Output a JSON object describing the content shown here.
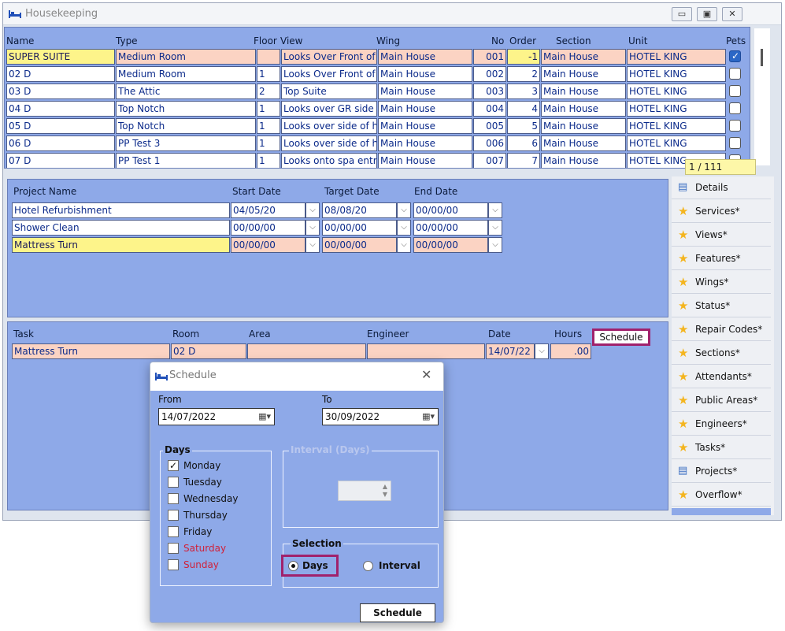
{
  "window": {
    "title": "Housekeeping",
    "controls": [
      "▭",
      "▣",
      "✕"
    ]
  },
  "rooms": {
    "headers": {
      "name": "Name",
      "type": "Type",
      "floor": "Floor",
      "view": "View",
      "wing": "Wing",
      "no": "No",
      "order": "Order",
      "section": "Section",
      "unit": "Unit",
      "pets": "Pets"
    },
    "rows": [
      {
        "name": "SUPER SUITE",
        "type": "Medium Room",
        "floor": "",
        "view": "Looks Over Front of",
        "wing": "Main House",
        "no": "001",
        "order": "-1",
        "section": "Main House",
        "unit": "HOTEL KING",
        "pets": true
      },
      {
        "name": "02 D",
        "type": "Medium Room",
        "floor": "1",
        "view": "Looks Over Front of",
        "wing": "Main House",
        "no": "002",
        "order": "2",
        "section": "Main House",
        "unit": "HOTEL KING",
        "pets": false
      },
      {
        "name": "03 D",
        "type": "The Attic",
        "floor": "2",
        "view": "Top Suite",
        "wing": "Main House",
        "no": "003",
        "order": "3",
        "section": "Main House",
        "unit": "HOTEL KING",
        "pets": false
      },
      {
        "name": "04 D",
        "type": "Top Notch",
        "floor": "1",
        "view": "Looks over GR side",
        "wing": "Main House",
        "no": "004",
        "order": "4",
        "section": "Main House",
        "unit": "HOTEL KING",
        "pets": false
      },
      {
        "name": "05 D",
        "type": "Top Notch",
        "floor": "1",
        "view": "Looks over side of h",
        "wing": "Main House",
        "no": "005",
        "order": "5",
        "section": "Main House",
        "unit": "HOTEL KING",
        "pets": false
      },
      {
        "name": "06 D",
        "type": "PP Test 3",
        "floor": "1",
        "view": "Looks over side of h",
        "wing": "Main House",
        "no": "006",
        "order": "6",
        "section": "Main House",
        "unit": "HOTEL KING",
        "pets": false
      },
      {
        "name": "07 D",
        "type": "PP Test 1",
        "floor": "1",
        "view": "Looks onto spa entr",
        "wing": "Main House",
        "no": "007",
        "order": "7",
        "section": "Main House",
        "unit": "HOTEL KING",
        "pets": false
      }
    ],
    "pager": "1 / 111"
  },
  "projects": {
    "headers": {
      "name": "Project Name",
      "start": "Start Date",
      "target": "Target Date",
      "end": "End Date"
    },
    "rows": [
      {
        "name": "Hotel Refurbishment",
        "start": "04/05/20",
        "target": "08/08/20",
        "end": "00/00/00"
      },
      {
        "name": "Shower Clean",
        "start": "00/00/00",
        "target": "00/00/00",
        "end": "00/00/00"
      },
      {
        "name": "Mattress Turn",
        "start": "00/00/00",
        "target": "00/00/00",
        "end": "00/00/00"
      }
    ]
  },
  "tasks": {
    "headers": {
      "task": "Task",
      "room": "Room",
      "area": "Area",
      "engineer": "Engineer",
      "date": "Date",
      "hours": "Hours"
    },
    "rows": [
      {
        "task": "Mattress Turn",
        "room": "02 D",
        "area": "",
        "engineer": "",
        "date": "14/07/22",
        "hours": ".00"
      }
    ],
    "schedule_button": "Schedule"
  },
  "sidenav": [
    {
      "label": "Details",
      "icon": "document-icon"
    },
    {
      "label": "Services*",
      "icon": "star-icon"
    },
    {
      "label": "Views*",
      "icon": "star-icon"
    },
    {
      "label": "Features*",
      "icon": "star-icon"
    },
    {
      "label": "Wings*",
      "icon": "star-icon"
    },
    {
      "label": "Status*",
      "icon": "star-icon"
    },
    {
      "label": "Repair Codes*",
      "icon": "star-icon"
    },
    {
      "label": "Sections*",
      "icon": "star-icon"
    },
    {
      "label": "Attendants*",
      "icon": "star-icon"
    },
    {
      "label": "Public Areas*",
      "icon": "star-icon"
    },
    {
      "label": "Engineers*",
      "icon": "star-icon"
    },
    {
      "label": "Tasks*",
      "icon": "star-icon"
    },
    {
      "label": "Projects*",
      "icon": "document-icon"
    },
    {
      "label": "Overflow*",
      "icon": "star-icon"
    }
  ],
  "dialog": {
    "title": "Schedule",
    "from_label": "From",
    "to_label": "To",
    "from_value": "14/07/2022",
    "to_value": "30/09/2022",
    "days_group": "Days",
    "days": [
      {
        "label": "Monday",
        "checked": true,
        "weekend": false
      },
      {
        "label": "Tuesday",
        "checked": false,
        "weekend": false
      },
      {
        "label": "Wednesday",
        "checked": false,
        "weekend": false
      },
      {
        "label": "Thursday",
        "checked": false,
        "weekend": false
      },
      {
        "label": "Friday",
        "checked": false,
        "weekend": false
      },
      {
        "label": "Saturday",
        "checked": false,
        "weekend": true
      },
      {
        "label": "Sunday",
        "checked": false,
        "weekend": true
      }
    ],
    "interval_group": "Interval (Days)",
    "interval_value": "",
    "selection_group": "Selection",
    "selection_days": "Days",
    "selection_interval": "Interval",
    "selected": "Days",
    "schedule_button": "Schedule"
  },
  "colors": {
    "panel": "#8ea9e8",
    "selected_row": "#fbd3c3",
    "current_cell": "#fdf48a",
    "highlight": "#a0216c",
    "weekend_text": "#d0213a"
  }
}
